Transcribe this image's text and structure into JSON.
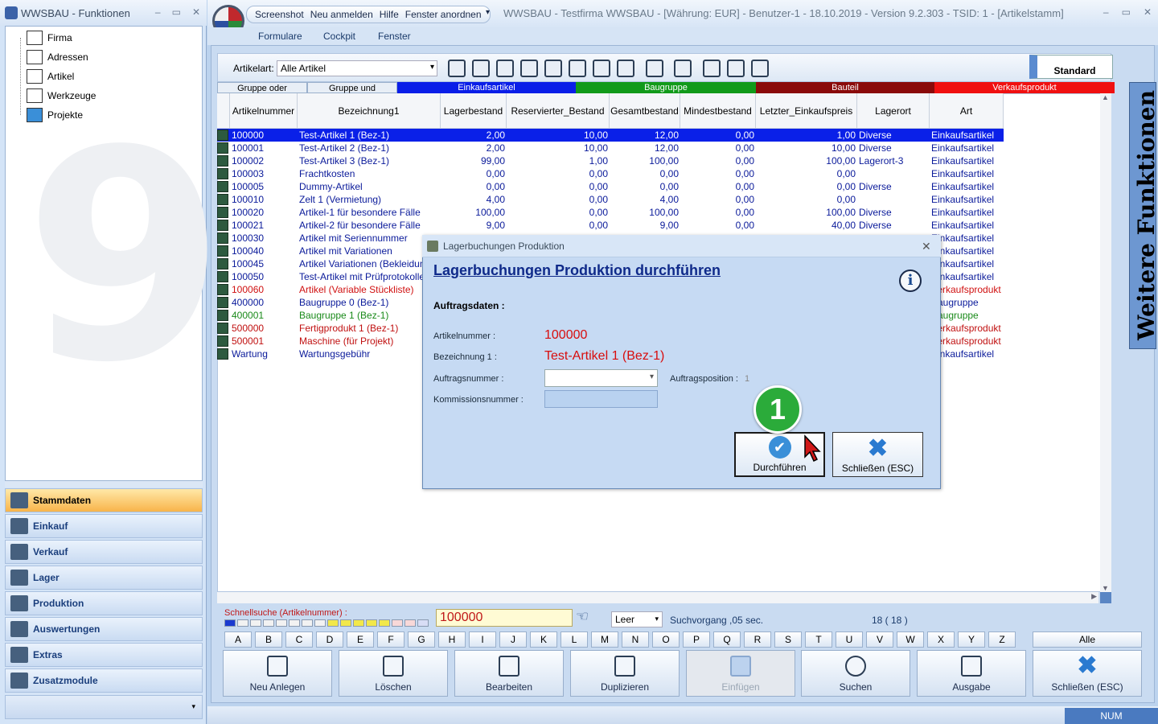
{
  "left_window": {
    "title": "WWSBAU - Funktionen",
    "tree": [
      "Firma",
      "Adressen",
      "Artikel",
      "Werkzeuge",
      "Projekte"
    ],
    "nav": [
      "Stammdaten",
      "Einkauf",
      "Verkauf",
      "Lager",
      "Produktion",
      "Auswertungen",
      "Extras",
      "Zusatzmodule"
    ]
  },
  "main_window": {
    "quick_access": [
      "Screenshot",
      "Neu anmelden",
      "Hilfe",
      "Fenster anordnen"
    ],
    "title": "WWSBAU - Testfirma WWSBAU - [Währung: EUR] - Benutzer-1 - 18.10.2019 - Version 9.2.303 - TSID: 1  - [Artikelstamm]",
    "menu": [
      "Formulare",
      "Cockpit",
      "Fenster"
    ],
    "toolbar": {
      "artikelart_label": "Artikelart:",
      "artikelart_value": "Alle Artikel",
      "standard_label": "Standard"
    },
    "filter_buttons": [
      {
        "label": "Gruppe oder",
        "color": "#e8eef6",
        "text_color": "#000"
      },
      {
        "label": "Gruppe und",
        "color": "#e8eef6",
        "text_color": "#000"
      },
      {
        "label": "Einkaufsartikel",
        "color": "#0a1ee8",
        "text_color": "#fff"
      },
      {
        "label": "Baugruppe",
        "color": "#119a1a",
        "text_color": "#fff"
      },
      {
        "label": "Bauteil",
        "color": "#8a0a0a",
        "text_color": "#fff"
      },
      {
        "label": "Verkaufsprodukt",
        "color": "#f01010",
        "text_color": "#fff"
      }
    ],
    "columns": [
      "Artikelnummer",
      "Bezeichnung1",
      "Lagerbestand",
      "Reservierter_Bestand",
      "Gesamtbestand",
      "Mindestbestand",
      "Letzter_Einkaufspreis",
      "Lagerort",
      "Art"
    ],
    "rows": [
      {
        "nr": "100000",
        "bez": "Test-Artikel 1  (Bez-1)",
        "lager": "2,00",
        "res": "10,00",
        "ges": "12,00",
        "min": "0,00",
        "ek": "1,00",
        "ort": "Diverse",
        "art": "Einkaufsartikel",
        "color": "#fff",
        "selected": true
      },
      {
        "nr": "100001",
        "bez": "Test-Artikel 2  (Bez-1)",
        "lager": "2,00",
        "res": "10,00",
        "ges": "12,00",
        "min": "0,00",
        "ek": "10,00",
        "ort": "Diverse",
        "art": "Einkaufsartikel",
        "color": "#0a1a9a"
      },
      {
        "nr": "100002",
        "bez": "Test-Artikel 3  (Bez-1)",
        "lager": "99,00",
        "res": "1,00",
        "ges": "100,00",
        "min": "0,00",
        "ek": "100,00",
        "ort": "Lagerort-3",
        "art": "Einkaufsartikel",
        "color": "#0a1a9a"
      },
      {
        "nr": "100003",
        "bez": "Frachtkosten",
        "lager": "0,00",
        "res": "0,00",
        "ges": "0,00",
        "min": "0,00",
        "ek": "0,00",
        "ort": "",
        "art": "Einkaufsartikel",
        "color": "#0a1a9a"
      },
      {
        "nr": "100005",
        "bez": "Dummy-Artikel",
        "lager": "0,00",
        "res": "0,00",
        "ges": "0,00",
        "min": "0,00",
        "ek": "0,00",
        "ort": "Diverse",
        "art": "Einkaufsartikel",
        "color": "#0a1a9a"
      },
      {
        "nr": "100010",
        "bez": "Zelt 1 (Vermietung)",
        "lager": "4,00",
        "res": "0,00",
        "ges": "4,00",
        "min": "0,00",
        "ek": "0,00",
        "ort": "",
        "art": "Einkaufsartikel",
        "color": "#0a1a9a"
      },
      {
        "nr": "100020",
        "bez": "Artikel-1 für besondere Fälle",
        "lager": "100,00",
        "res": "0,00",
        "ges": "100,00",
        "min": "0,00",
        "ek": "100,00",
        "ort": "Diverse",
        "art": "Einkaufsartikel",
        "color": "#0a1a9a"
      },
      {
        "nr": "100021",
        "bez": "Artikel-2 für besondere Fälle",
        "lager": "9,00",
        "res": "0,00",
        "ges": "9,00",
        "min": "0,00",
        "ek": "40,00",
        "ort": "Diverse",
        "art": "Einkaufsartikel",
        "color": "#0a1a9a"
      },
      {
        "nr": "100030",
        "bez": "Artikel mit Seriennummer",
        "art": "Einkaufsartikel",
        "color": "#0a1a9a"
      },
      {
        "nr": "100040",
        "bez": "Artikel mit Variationen",
        "art": "Einkaufsartikel",
        "color": "#0a1a9a"
      },
      {
        "nr": "100045",
        "bez": "Artikel Variationen (Bekleidung)",
        "art": "Einkaufsartikel",
        "color": "#0a1a9a"
      },
      {
        "nr": "100050",
        "bez": "Test-Artikel mit Prüfprotokollen",
        "art": "Einkaufsartikel",
        "color": "#0a1a9a"
      },
      {
        "nr": "100060",
        "bez": "Artikel (Variable Stückliste)",
        "art": "Verkaufsprodukt",
        "color": "#d01010"
      },
      {
        "nr": "400000",
        "bez": "Baugruppe 0  (Bez-1)",
        "art": "Baugruppe",
        "color": "#0a1a9a"
      },
      {
        "nr": "400001",
        "bez": "Baugruppe 1  (Bez-1)",
        "art": "Baugruppe",
        "color": "#1a8a1a"
      },
      {
        "nr": "500000",
        "bez": "Fertigprodukt 1  (Bez-1)",
        "art": "Verkaufsprodukt",
        "color": "#c01010"
      },
      {
        "nr": "500001",
        "bez": "Maschine (für Projekt)",
        "art": "Verkaufsprodukt",
        "color": "#c01010"
      },
      {
        "nr": "Wartung",
        "bez": "Wartungsgebühr",
        "art": "Einkaufsartikel",
        "color": "#0a1a9a"
      }
    ],
    "schnellsuche_label": "Schnellsuche (Artikelnummer) :",
    "schnellsuche_value": "100000",
    "leer_value": "Leer",
    "suchvorgang": "Suchvorgang ,05 sec.",
    "count": "18  ( 18 )",
    "letters": [
      "A",
      "B",
      "C",
      "D",
      "E",
      "F",
      "G",
      "H",
      "I",
      "J",
      "K",
      "L",
      "M",
      "N",
      "O",
      "P",
      "Q",
      "R",
      "S",
      "T",
      "U",
      "V",
      "W",
      "X",
      "Y",
      "Z"
    ],
    "alle_label": "Alle",
    "buttons": [
      "Neu Anlegen",
      "Löschen",
      "Bearbeiten",
      "Duplizieren",
      "Einfügen",
      "Suchen",
      "Ausgabe",
      "Schließen (ESC)"
    ],
    "status_num": "NUM",
    "side_panel": "Weitere Funktionen"
  },
  "dialog": {
    "title": "Lagerbuchungen Produktion",
    "heading": "Lagerbuchungen Produktion durchführen",
    "section": "Auftragsdaten :",
    "artikelnummer_label": "Artikelnummer :",
    "artikelnummer_value": "100000",
    "bezeichnung_label": "Bezeichnung 1 :",
    "bezeichnung_value": "Test-Artikel 1  (Bez-1)",
    "auftragsnummer_label": "Auftragsnummer :",
    "auftragsposition_label": "Auftragsposition :",
    "auftragsposition_value": "1",
    "kommissionsnummer_label": "Kommissionsnummer :",
    "durchfuehren_label": "Durchführen",
    "schliessen_label": "Schließen (ESC)",
    "step_badge": "1"
  }
}
